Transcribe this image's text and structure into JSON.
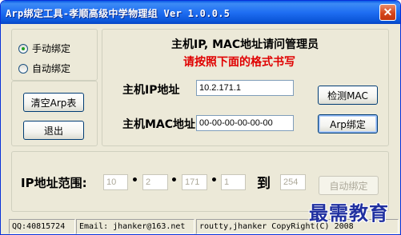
{
  "window": {
    "title": "Arp绑定工具-孝顺高级中学物理组 Ver 1.0.0.5",
    "close_glyph": "✕"
  },
  "mode": {
    "manual_label": "手动绑定",
    "auto_label": "自动绑定",
    "selected": "manual"
  },
  "left_buttons": {
    "clear_arp": "清空Arp表",
    "exit": "退出"
  },
  "main": {
    "heading": "主机IP, MAC地址请问管理员",
    "instruction": "请按照下面的格式书写",
    "ip_label": "主机IP地址",
    "ip_value": "10.2.171.1",
    "mac_label": "主机MAC地址",
    "mac_value": "00-00-00-00-00-00",
    "detect_mac_button": "检测MAC",
    "arp_bind_button": "Arp绑定"
  },
  "range": {
    "label": "IP地址范围:",
    "octet1": "10",
    "octet2": "2",
    "octet3": "171",
    "start": "1",
    "to_label": "到",
    "end": "254",
    "auto_bind_button": "自动绑定"
  },
  "statusbar": {
    "qq": "QQ:40815724",
    "email": "Email: jhanker@163.net",
    "copyright": "routty,jhanker CopyRight(C) 2008"
  },
  "watermark": "最需教育"
}
